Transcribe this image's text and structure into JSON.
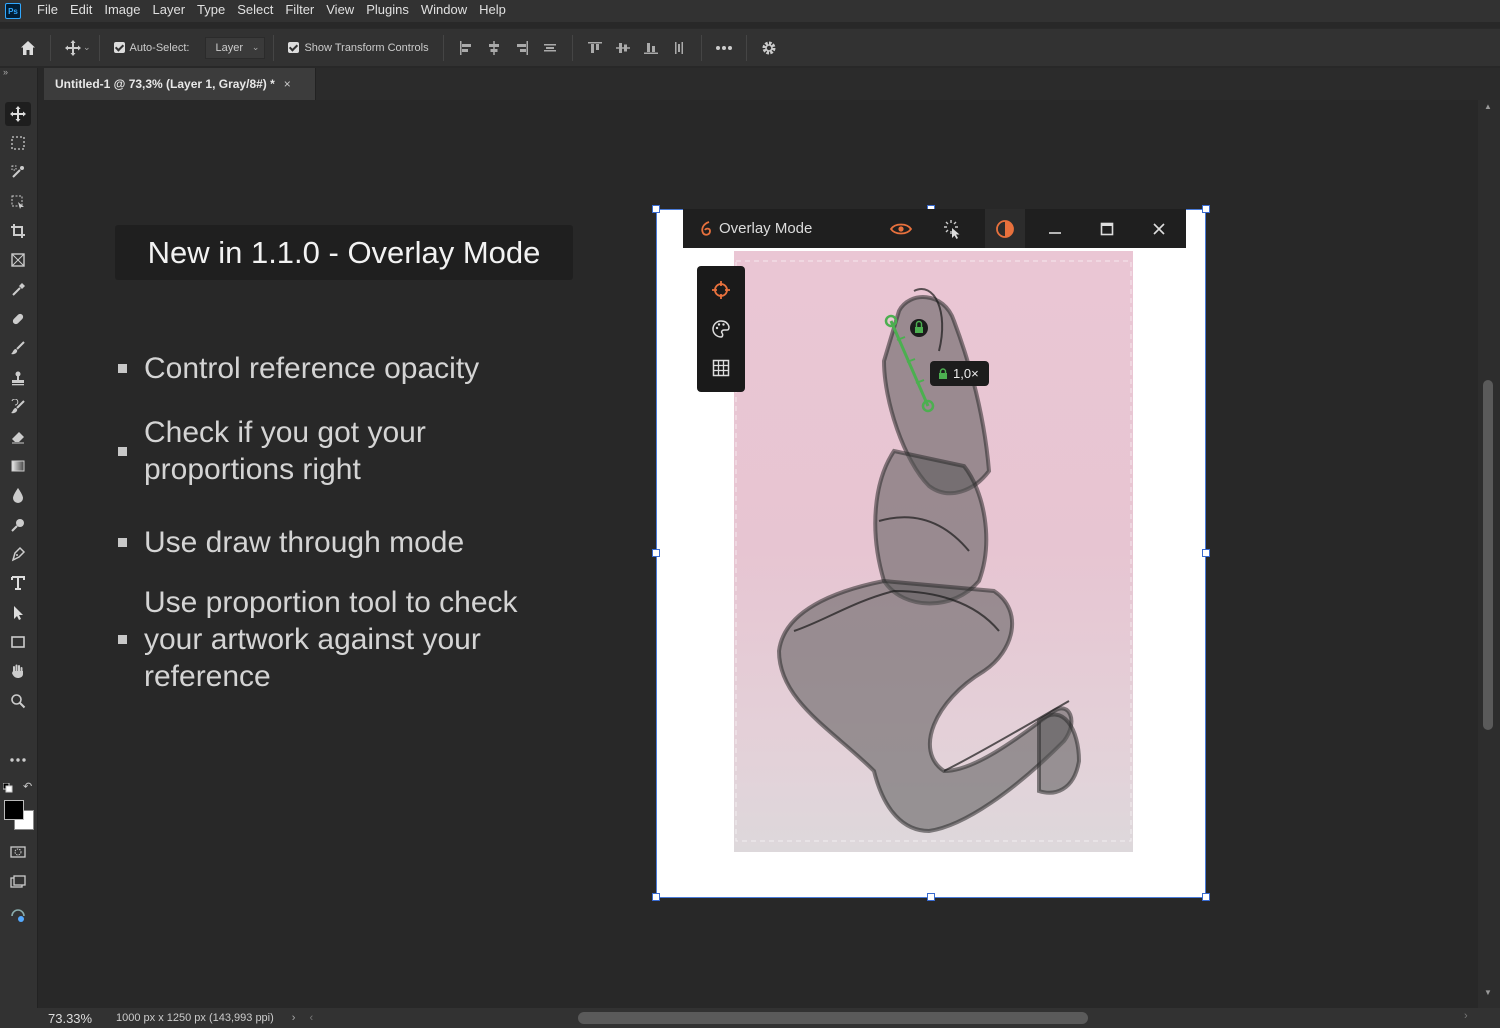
{
  "app": {
    "logo": "Ps"
  },
  "menu": [
    "File",
    "Edit",
    "Image",
    "Layer",
    "Type",
    "Select",
    "Filter",
    "View",
    "Plugins",
    "Window",
    "Help"
  ],
  "options": {
    "auto_select_label": "Auto-Select:",
    "auto_select_value": "Layer",
    "show_transform_label": "Show Transform Controls"
  },
  "document_tab": {
    "title": "Untitled-1 @ 73,3% (Layer 1, Gray/8#) *",
    "close": "×"
  },
  "slide": {
    "headline": "New in 1.1.0 - Overlay Mode",
    "bullets": [
      "Control reference opacity",
      "Check if you got your proportions right",
      "Use draw through mode",
      "Use proportion tool to check your artwork against your reference"
    ]
  },
  "overlay": {
    "title": "Overlay Mode",
    "ratio_badge": "1,0×",
    "accent_color": "#e8713d",
    "guide_color": "#4caf50"
  },
  "status": {
    "zoom": "73.33%",
    "doc_info": "1000 px x 1250 px (143,993 ppi)"
  },
  "icons": {
    "toolbar": [
      "move-tool-icon",
      "marquee-tool-icon",
      "object-selection-icon",
      "frame-select-icon",
      "crop-tool-icon",
      "frame-tool-icon",
      "eyedropper-icon",
      "healing-brush-icon",
      "brush-tool-icon",
      "clone-stamp-icon",
      "history-brush-icon",
      "eraser-icon",
      "gradient-icon",
      "blur-icon",
      "dodge-icon",
      "pen-tool-icon",
      "type-tool-icon",
      "path-select-icon",
      "rectangle-tool-icon",
      "hand-tool-icon",
      "zoom-tool-icon",
      "more-tools-icon"
    ]
  }
}
